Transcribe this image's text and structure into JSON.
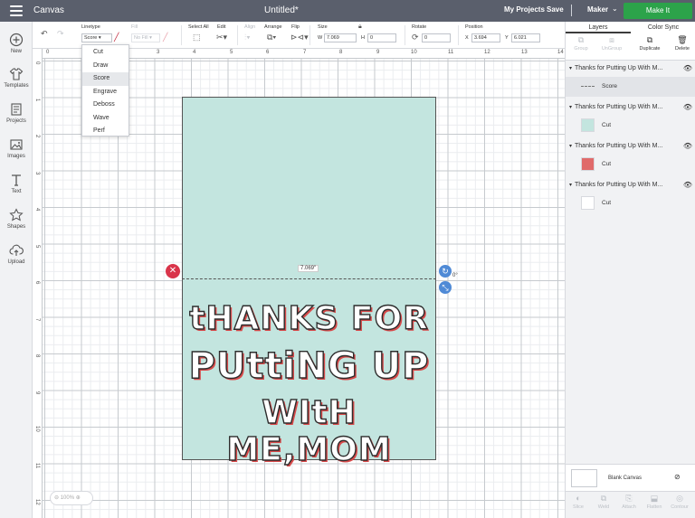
{
  "header": {
    "app_title": "Canvas",
    "doc_title": "Untitled*",
    "my_projects": "My Projects",
    "save": "Save",
    "machine": "Maker",
    "make_it": "Make It"
  },
  "sidebar": {
    "items": [
      {
        "label": "New",
        "icon": "plus-circle-icon"
      },
      {
        "label": "Templates",
        "icon": "shirt-icon"
      },
      {
        "label": "Projects",
        "icon": "projects-icon"
      },
      {
        "label": "Images",
        "icon": "images-icon"
      },
      {
        "label": "Text",
        "icon": "text-icon"
      },
      {
        "label": "Shapes",
        "icon": "shapes-icon"
      },
      {
        "label": "Upload",
        "icon": "upload-icon"
      }
    ]
  },
  "toolbar": {
    "linetype_label": "Linetype",
    "linetype_value": "Score",
    "fill_label": "Fill",
    "fill_value": "No Fill",
    "select_all_label": "Select All",
    "edit_label": "Edit",
    "align_label": "Align",
    "arrange_label": "Arrange",
    "flip_label": "Flip",
    "size_label": "Size",
    "size_w_label": "W",
    "size_w_value": "7.069",
    "size_h_label": "H",
    "size_h_value": "0",
    "rotate_label": "Rotate",
    "rotate_value": "0",
    "position_label": "Position",
    "pos_x_label": "X",
    "pos_x_value": "3.694",
    "pos_y_label": "Y",
    "pos_y_value": "6.021"
  },
  "linetype_menu": {
    "options": [
      "Cut",
      "Draw",
      "Score",
      "Engrave",
      "Deboss",
      "Wave",
      "Perf"
    ],
    "selected": "Score"
  },
  "rulers": {
    "top": [
      "0",
      "1",
      "2",
      "3",
      "4",
      "5",
      "6",
      "7",
      "8",
      "9",
      "10",
      "11",
      "12",
      "13",
      "14"
    ],
    "left": [
      "0",
      "1",
      "2",
      "3",
      "4",
      "5",
      "6",
      "7",
      "8",
      "9",
      "10",
      "11",
      "12"
    ]
  },
  "canvas": {
    "card_color": "#c3e5df",
    "text_line1": "tHANKS FOR",
    "text_line2": "PUttiNG UP",
    "text_line3": "WItH ME,MOM",
    "width_readout": "7.069\"",
    "rotation_readout": "0°",
    "zoom": "100%"
  },
  "layers_panel": {
    "tabs": [
      "Layers",
      "Color Sync"
    ],
    "tools": [
      "Group",
      "UnGroup",
      "Duplicate",
      "Delete"
    ],
    "groups": [
      {
        "title": "Thanks for Putting Up With M...",
        "sub": "Score"
      },
      {
        "title": "Thanks for Putting Up With M...",
        "sub": "Cut"
      },
      {
        "title": "Thanks for Putting Up With M...",
        "sub": "Cut"
      },
      {
        "title": "Thanks for Putting Up With M...",
        "sub": "Cut"
      }
    ],
    "blank_canvas": "Blank Canvas",
    "bottom_tools": [
      "Slice",
      "Weld",
      "Attach",
      "Flatten",
      "Contour"
    ]
  }
}
